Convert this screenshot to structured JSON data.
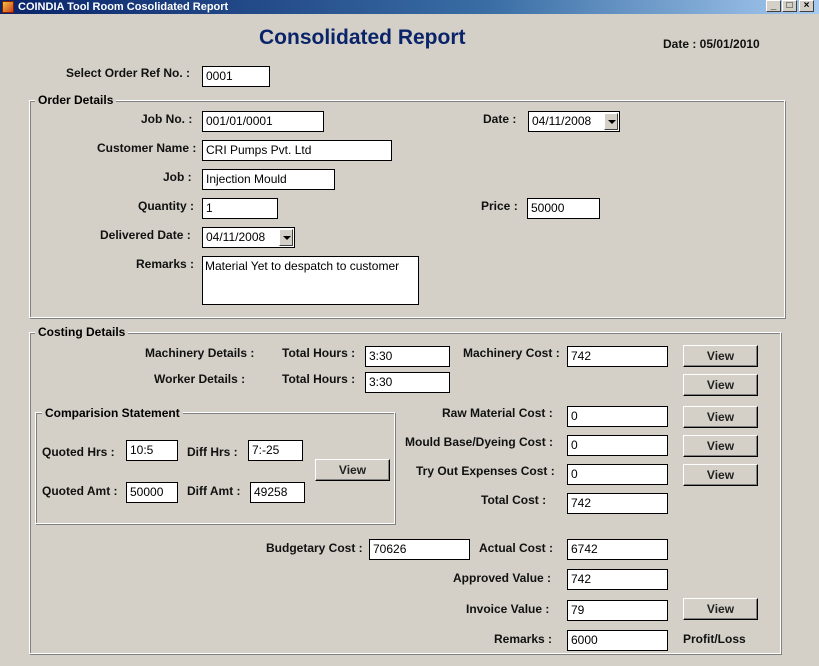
{
  "window": {
    "title": "COINDIA Tool Room Cosolidated Report",
    "min": "_",
    "max": "□",
    "close": "×"
  },
  "heading": "Consolidated Report",
  "report_date": "Date : 05/01/2010",
  "select_order": {
    "label": "Select Order Ref No. :",
    "value": "0001"
  },
  "order_details": {
    "title": "Order Details",
    "job_no": {
      "label": "Job No. :",
      "value": "001/01/0001"
    },
    "date": {
      "label": "Date :",
      "value": "04/11/2008"
    },
    "customer_name": {
      "label": "Customer Name :",
      "value": "CRI Pumps Pvt. Ltd"
    },
    "job": {
      "label": "Job :",
      "value": "Injection Mould"
    },
    "quantity": {
      "label": "Quantity :",
      "value": "1"
    },
    "price": {
      "label": "Price :",
      "value": "50000"
    },
    "delivered_date": {
      "label": "Delivered Date :",
      "value": "04/11/2008"
    },
    "remarks": {
      "label": "Remarks :",
      "value": "Material Yet to despatch to customer"
    }
  },
  "costing_details": {
    "title": "Costing Details",
    "machinery_details": "Machinery Details :",
    "worker_details": "Worker Details :",
    "total_hours_label": "Total Hours :",
    "machinery_hours": "3:30",
    "worker_hours": "3:30",
    "machinery_cost": {
      "label": "Machinery Cost :",
      "value": "742"
    },
    "raw_material_cost": {
      "label": "Raw Material Cost :",
      "value": "0"
    },
    "mould_base_cost": {
      "label": "Mould Base/Dyeing Cost :",
      "value": "0"
    },
    "try_out_cost": {
      "label": "Try Out Expenses Cost :",
      "value": "0"
    },
    "total_cost": {
      "label": "Total Cost :",
      "value": "742"
    },
    "view_label": "View"
  },
  "comparison": {
    "title": "Comparision Statement",
    "quoted_hrs": {
      "label": "Quoted Hrs :",
      "value": "10:5"
    },
    "diff_hrs": {
      "label": "Diff Hrs :",
      "value": "7:-25"
    },
    "quoted_amt": {
      "label": "Quoted Amt :",
      "value": "50000"
    },
    "diff_amt": {
      "label": "Diff Amt :",
      "value": "49258"
    },
    "view_label": "View"
  },
  "summary": {
    "budgetary_cost": {
      "label": "Budgetary Cost :",
      "value": "70626"
    },
    "actual_cost": {
      "label": "Actual Cost :",
      "value": "6742"
    },
    "approved_value": {
      "label": "Approved Value :",
      "value": "742"
    },
    "invoice_value": {
      "label": "Invoice Value :",
      "value": "79"
    },
    "remarks": {
      "label": "Remarks :",
      "value": "6000"
    },
    "profit_loss": "Profit/Loss",
    "view_label": "View"
  }
}
